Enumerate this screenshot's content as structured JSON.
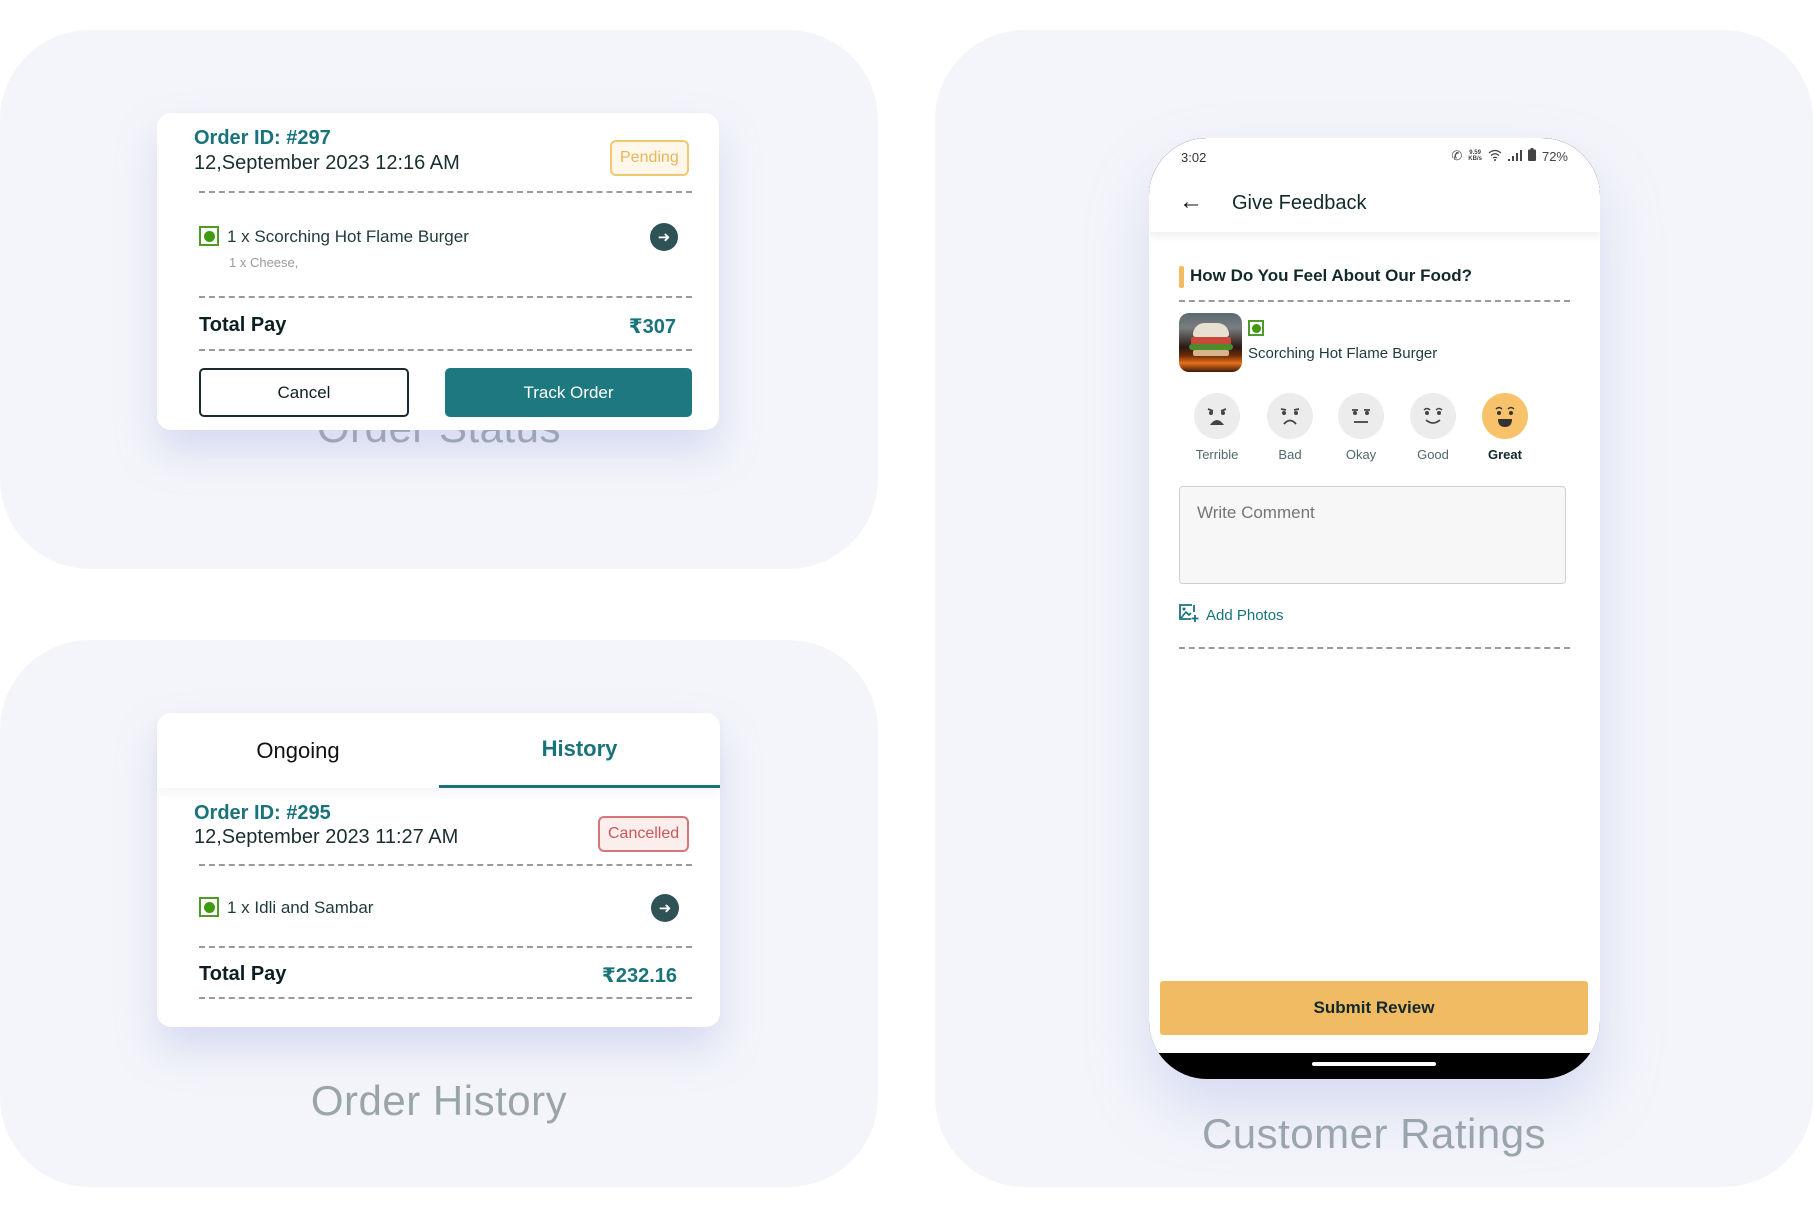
{
  "panels": {
    "order_status": {
      "caption": "Order Status",
      "order_id": "Order ID: #297",
      "date": "12,September 2023 12:16 AM",
      "status_badge": "Pending",
      "items": [
        {
          "qty_name": "1 x Scorching Hot Flame Burger",
          "addon": "1 x Cheese,",
          "veg": true
        }
      ],
      "total_label": "Total Pay",
      "total_value": "₹307",
      "buttons": {
        "cancel": "Cancel",
        "track": "Track Order"
      }
    },
    "order_history": {
      "caption": "Order History",
      "tabs": [
        {
          "label": "Ongoing",
          "active": false
        },
        {
          "label": "History",
          "active": true
        }
      ],
      "order_id": "Order ID: #295",
      "date": "12,September 2023 11:27 AM",
      "status_badge": "Cancelled",
      "items": [
        {
          "qty_name": "1 x Idli and Sambar",
          "veg": true
        }
      ],
      "total_label": "Total Pay",
      "total_value": "₹232.16"
    },
    "customer_ratings": {
      "caption": "Customer Ratings",
      "status_bar": {
        "time": "3:02",
        "net_speed_value": "9.59",
        "net_speed_unit": "KB/s",
        "battery": "72%",
        "icons": [
          "call-icon",
          "wifi-icon",
          "signal-icon",
          "battery-icon"
        ]
      },
      "app_bar": {
        "back_icon": "arrow-left-icon",
        "title": "Give Feedback"
      },
      "question": "How Do You Feel About Our Food?",
      "food": {
        "name": "Scorching Hot Flame Burger",
        "veg": true
      },
      "ratings": [
        {
          "label": "Terrible",
          "selected": false
        },
        {
          "label": "Bad",
          "selected": false
        },
        {
          "label": "Okay",
          "selected": false
        },
        {
          "label": "Good",
          "selected": false
        },
        {
          "label": "Great",
          "selected": true
        }
      ],
      "comment_placeholder": "Write Comment",
      "add_photos": "Add Photos",
      "submit": "Submit Review"
    }
  },
  "colors": {
    "primary": "#19737a",
    "accent": "#f1bb63",
    "pending": "#e8b55a",
    "cancelled": "#c8575a",
    "veg": "#3f9a12",
    "panel_bg": "#f4f5fa"
  }
}
